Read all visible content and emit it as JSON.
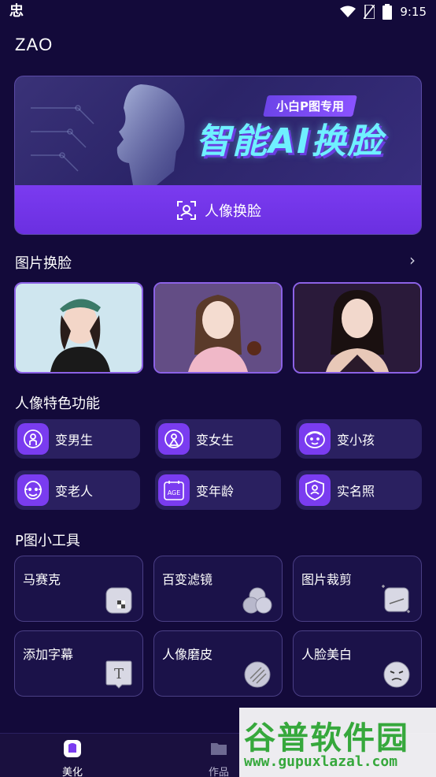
{
  "status_bar": {
    "left_icon": "app-notification-icon",
    "time": "9:15"
  },
  "app": {
    "title": "ZAO"
  },
  "banner": {
    "tag": "小白P图专用",
    "title": "智能AI换脸",
    "button_label": "人像换脸"
  },
  "photo_face_swap": {
    "title": "图片换脸",
    "photos": [
      "photo-1",
      "photo-2",
      "photo-3"
    ]
  },
  "portrait_features": {
    "title": "人像特色功能",
    "items": [
      {
        "label": "变男生",
        "icon": "male-icon"
      },
      {
        "label": "变女生",
        "icon": "female-icon"
      },
      {
        "label": "变小孩",
        "icon": "child-face-icon"
      },
      {
        "label": "变老人",
        "icon": "elder-face-icon"
      },
      {
        "label": "变年龄",
        "icon": "age-calendar-icon",
        "icon_text": "AGE"
      },
      {
        "label": "实名照",
        "icon": "id-photo-icon"
      }
    ]
  },
  "tools": {
    "title": "P图小工具",
    "items": [
      {
        "label": "马赛克",
        "icon": "mosaic-icon"
      },
      {
        "label": "百变滤镜",
        "icon": "filter-icon"
      },
      {
        "label": "图片裁剪",
        "icon": "crop-icon"
      },
      {
        "label": "添加字幕",
        "icon": "subtitle-icon",
        "icon_text": "T"
      },
      {
        "label": "人像磨皮",
        "icon": "smooth-skin-icon"
      },
      {
        "label": "人脸美白",
        "icon": "whitening-face-icon"
      }
    ]
  },
  "bottom_nav": {
    "items": [
      {
        "label": "美化",
        "active": true
      },
      {
        "label": "作品",
        "active": false
      }
    ]
  },
  "watermark": {
    "title": "谷普软件园",
    "url": "www.gupuxlazal.com"
  },
  "colors": {
    "background": "#130a3a",
    "accent": "#7a3cf0",
    "card": "#2a2060"
  }
}
